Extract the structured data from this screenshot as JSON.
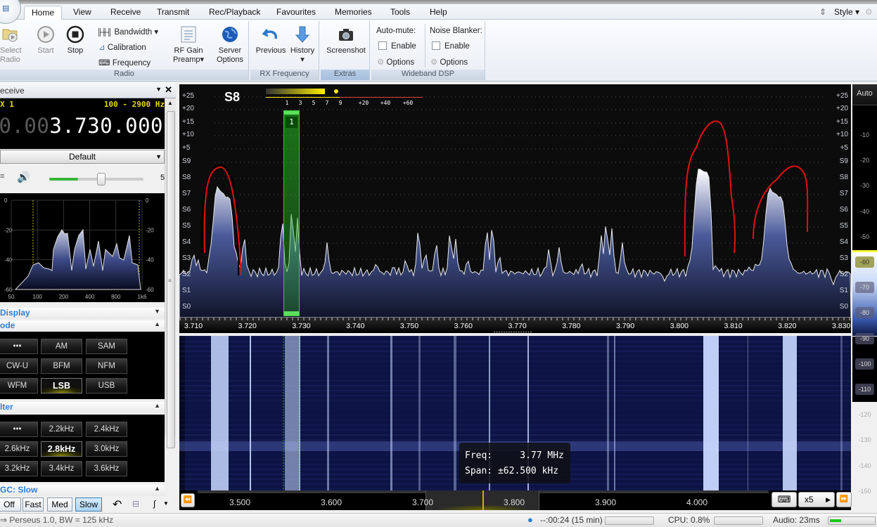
{
  "menu": {
    "tabs": [
      "Home",
      "View",
      "Receive",
      "Transmit",
      "Rec/Playback",
      "Favourites",
      "Memories",
      "Tools",
      "Help"
    ],
    "active_tab": "Home",
    "style_label": "Style"
  },
  "ribbon": {
    "radio": {
      "group_label": "Radio",
      "select_radio": "Select\nRadio",
      "start": "Start",
      "stop": "Stop",
      "bandwidth": "Bandwidth",
      "calibration": "Calibration",
      "frequency": "Frequency",
      "rf_gain": "RF Gain",
      "preamp": "Preamp",
      "server": "Server",
      "options": "Options"
    },
    "rx_frequency": {
      "group_label": "RX Frequency",
      "previous": "Previous",
      "history": "History"
    },
    "extras": {
      "group_label": "Extras",
      "screenshot": "Screenshot"
    },
    "wideband_dsp": {
      "group_label": "Wideband DSP",
      "auto_mute": "Auto-mute:",
      "noise_blanker": "Noise Blanker:",
      "enable": "Enable",
      "options": "Options",
      "auto_mute_enabled": false,
      "noise_blanker_enabled": false
    }
  },
  "receive_panel": {
    "title": "eceive",
    "rx_label": "X 1",
    "bandwidth_range": "100 - 2900 Hz",
    "frequency_dim": "0.00",
    "frequency_main": "3.730.000",
    "preset": "Default",
    "volume_value": "5",
    "volume_level": 0.55,
    "audio_spectrum": {
      "y_ticks": [
        "0",
        "-20",
        "-40",
        "-60"
      ],
      "x_ticks": [
        "50",
        "100",
        "200",
        "400",
        "800",
        "1k6"
      ]
    },
    "display_section": "Display",
    "mode_section": "ode",
    "modes": [
      "•••",
      "AM",
      "SAM",
      "CW-U",
      "BFM",
      "NFM",
      "WFM",
      "LSB",
      "USB"
    ],
    "selected_mode": "LSB",
    "filter_section": "lter",
    "filters": [
      "•••",
      "2.2kHz",
      "2.4kHz",
      "2.6kHz",
      "2.8kHz",
      "3.0kHz",
      "3.2kHz",
      "3.4kHz",
      "3.6kHz"
    ],
    "selected_filter": "2.8kHz",
    "agc_section": "GC: Slow",
    "agc_buttons": [
      "Off",
      "Fast",
      "Med",
      "Slow"
    ],
    "selected_agc": "Slow"
  },
  "spectrum": {
    "s_reading": "S8",
    "meter_scale": [
      "1",
      "3",
      "5",
      "7",
      "9",
      "+20",
      "+40",
      "+60"
    ],
    "meter_level_s": 8,
    "left_scale": [
      "+25",
      "+20",
      "+15",
      "+10",
      "+5",
      "S9",
      "S8",
      "S7",
      "S6",
      "S5",
      "S4",
      "S3",
      "S2",
      "S1",
      "S0"
    ],
    "right_scale": [
      "+25",
      "+20",
      "+15",
      "+10",
      "+5",
      "S9",
      "S8",
      "S7",
      "S6",
      "S5",
      "S4",
      "S3",
      "S2",
      "S1",
      "S0"
    ],
    "channel_marker": "1",
    "freq_ticks": [
      "3.710",
      "3.720",
      "3.730",
      "3.740",
      "3.750",
      "3.760",
      "3.770",
      "3.780",
      "3.790",
      "3.800",
      "3.810",
      "3.820",
      "3.830"
    ],
    "band_ticks": [
      "3.500",
      "3.600",
      "3.700",
      "3.800",
      "3.900",
      "4.000"
    ],
    "zoom": "x5",
    "db_scale_auto": "Auto",
    "db_scale": [
      "-10",
      "-20",
      "-30",
      "-40",
      "-50",
      "-60",
      "-70",
      "-80",
      "-90",
      "-100",
      "-110",
      "-120",
      "-130",
      "-140",
      "-150"
    ]
  },
  "tooltip": {
    "freq_line": "Freq:     3.77 MHz",
    "span_line": "Span: ±62.500 kHz"
  },
  "status": {
    "device": "⇒ Perseus 1.0, BW = 125 kHz",
    "time": "--:00:24 (15 min)",
    "cpu": "CPU: 0.8%",
    "audio": "Audio: 23ms",
    "audio_buffer_level": 0.25
  },
  "colors": {
    "accent_blue": "#2b7fd8",
    "meter_yellow": "#e7d600",
    "marker_green": "#3cc83c",
    "annotation_red": "#e01010"
  }
}
